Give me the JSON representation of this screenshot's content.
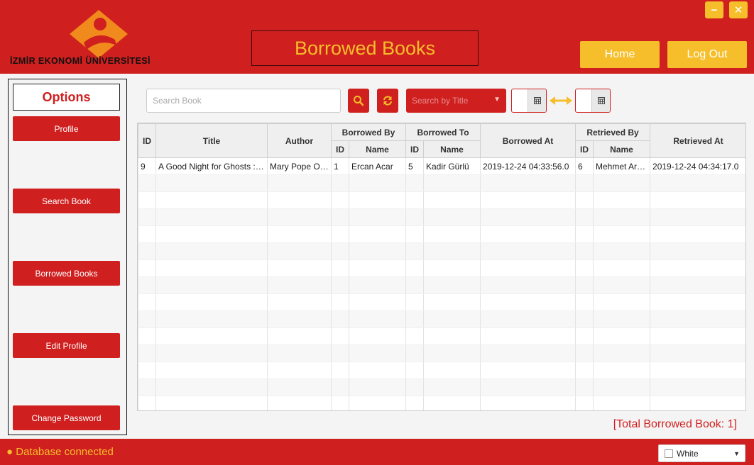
{
  "header": {
    "logo_text": "İZMİR EKONOMİ ÜNİVERSİTESİ",
    "title": "Borrowed Books",
    "home_label": "Home",
    "logout_label": "Log Out",
    "minimize_symbol": "−",
    "close_symbol": "✕"
  },
  "sidebar": {
    "options_label": "Options",
    "items": [
      {
        "label": "Profile"
      },
      {
        "label": "Search Book"
      },
      {
        "label": "Borrowed Books"
      },
      {
        "label": "Edit Profile"
      },
      {
        "label": "Change Password"
      }
    ]
  },
  "toolbar": {
    "search_placeholder": "Search Book",
    "search_icon": "search-icon",
    "refresh_icon": "refresh-icon",
    "search_by": "Search by Title"
  },
  "table": {
    "headers": {
      "id": "ID",
      "title": "Title",
      "author": "Author",
      "borrowed_by": "Borrowed By",
      "borrowed_to": "Borrowed To",
      "borrowed_at": "Borrowed At",
      "retrieved_by": "Retrieved By",
      "retrieved_at": "Retrieved At",
      "sub_id": "ID",
      "sub_name": "Name"
    },
    "rows": [
      {
        "id": "9",
        "title": "A Good Night for Ghosts : Magic Tree House",
        "author": "Mary Pope Osborne",
        "by_id": "1",
        "by_name": "Ercan Acar",
        "to_id": "5",
        "to_name": "Kadir Gürlü",
        "borrowed_at": "2019-12-24 04:33:56.0",
        "ret_id": "6",
        "ret_name": "Mehmet Arıkan",
        "retrieved_at": "2019-12-24 04:34:17.0"
      }
    ],
    "empty_rows": 14
  },
  "total_text": "[Total Borrowed Book: 1]",
  "status": {
    "text": "Database connected",
    "theme": "White"
  },
  "colors": {
    "brand_red": "#d01f1f",
    "accent_yellow": "#f6be2a",
    "logo_orange": "#f08a1c"
  }
}
